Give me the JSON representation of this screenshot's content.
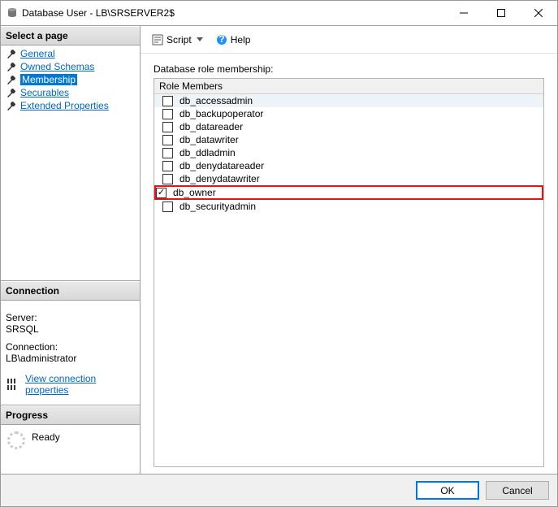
{
  "title": "Database User - LB\\SRSERVER2$",
  "sidebar": {
    "select_page_header": "Select a page",
    "nav_items": [
      {
        "label": "General",
        "selected": false
      },
      {
        "label": "Owned Schemas",
        "selected": false
      },
      {
        "label": "Membership",
        "selected": true
      },
      {
        "label": "Securables",
        "selected": false
      },
      {
        "label": "Extended Properties",
        "selected": false
      }
    ],
    "connection_header": "Connection",
    "server_label": "Server:",
    "server_value": "SRSQL",
    "connection_label": "Connection:",
    "connection_value": "LB\\administrator",
    "view_props_link": "View connection properties",
    "progress_header": "Progress",
    "progress_status": "Ready"
  },
  "toolbar": {
    "script_label": "Script",
    "help_label": "Help"
  },
  "content": {
    "membership_label": "Database role membership:",
    "column_header": "Role Members",
    "roles": [
      {
        "name": "db_accessadmin",
        "checked": false,
        "highlighted": false
      },
      {
        "name": "db_backupoperator",
        "checked": false,
        "highlighted": false
      },
      {
        "name": "db_datareader",
        "checked": false,
        "highlighted": false
      },
      {
        "name": "db_datawriter",
        "checked": false,
        "highlighted": false
      },
      {
        "name": "db_ddladmin",
        "checked": false,
        "highlighted": false
      },
      {
        "name": "db_denydatareader",
        "checked": false,
        "highlighted": false
      },
      {
        "name": "db_denydatawriter",
        "checked": false,
        "highlighted": false
      },
      {
        "name": "db_owner",
        "checked": true,
        "highlighted": true
      },
      {
        "name": "db_securityadmin",
        "checked": false,
        "highlighted": false
      }
    ]
  },
  "footer": {
    "ok_label": "OK",
    "cancel_label": "Cancel"
  }
}
